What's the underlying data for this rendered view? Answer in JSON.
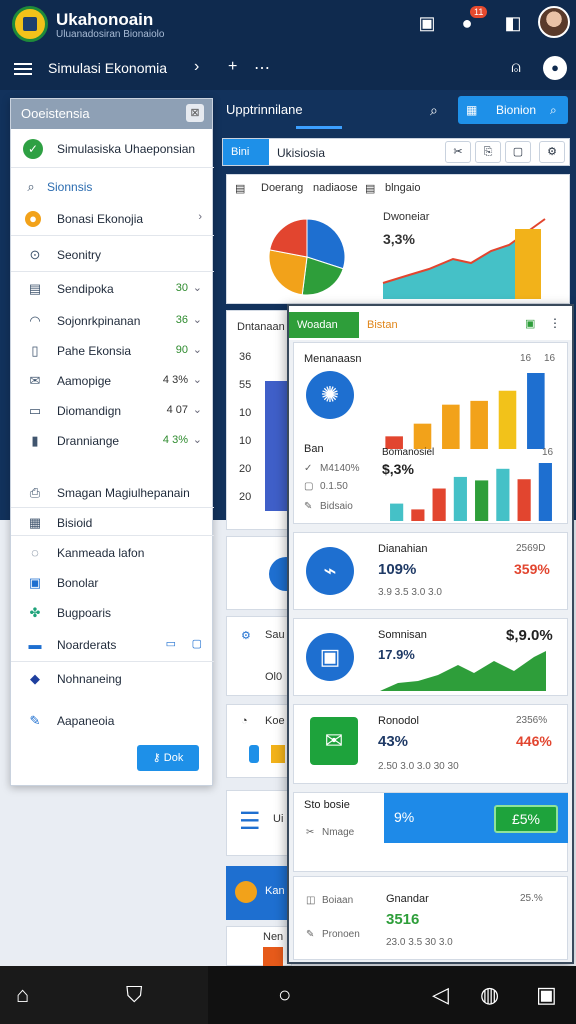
{
  "status": {
    "app_title": "Ukahonoain",
    "app_sub": "Uluanadosiran Bionaiolo",
    "notif_count": "11"
  },
  "appbar": {
    "title": "Simulasi Ekonomia"
  },
  "drawer": {
    "header": "Ooeistensia",
    "items": [
      {
        "label": "Simulasiska Uhaeponsian"
      },
      {
        "label": "Sionnsis"
      },
      {
        "label": "Bonasi Ekonojia"
      },
      {
        "label": "Seonitry"
      },
      {
        "label": "Sendipoka",
        "value": "30"
      },
      {
        "label": "Sojonrkpinanan",
        "value": "36"
      },
      {
        "label": "Pahe Ekonsia",
        "value": "90"
      },
      {
        "label": "Aamopige",
        "value": "4 3%"
      },
      {
        "label": "Diomandign",
        "value": "4 07"
      },
      {
        "label": "Dranniange",
        "value": "4 3%"
      },
      {
        "label": "Smagan Magiulhepanain"
      },
      {
        "label": "Bisioid"
      },
      {
        "label": "Kanmeada lafon"
      },
      {
        "label": "Bonolar"
      },
      {
        "label": "Bugpoaris"
      },
      {
        "label": "Noarderats"
      },
      {
        "label": "Nohnaneing"
      },
      {
        "label": "Aapaneoia"
      }
    ],
    "ok_label": "Dok"
  },
  "main": {
    "title": "Upptrinnilane",
    "top_button": "Bionion",
    "tab_active": "Bini",
    "tab_label": "Ukisiosia",
    "card1": {
      "header_left": "Doerang",
      "header_mid": "nadiaose",
      "header_right": "blngaio",
      "chart_label": "Dwoneiar",
      "chart_value": "3,3%"
    },
    "card2_label": "Dntanaan",
    "left_axis": [
      "36",
      "55",
      "10",
      "10",
      "20",
      "20"
    ],
    "card3_label": "Sau",
    "card3_val": "Ol0",
    "card4_label": "Koe",
    "card5_label": "Ui",
    "card6_label": "Kan",
    "card7_label": "Nen"
  },
  "overlay": {
    "tab_active": "Woadan",
    "tab2": "Bistan",
    "panel1": {
      "title": "Menanaasn",
      "label": "Ban",
      "r1": "M4140%",
      "r2": "0.1.50",
      "r3": "Bidsaio",
      "bar_label": "Bomanosiel",
      "bar_value": "$,3%",
      "axis": [
        "16",
        "16",
        "16"
      ]
    },
    "card_a": {
      "title": "Dianahian",
      "value": "109%",
      "right_label": "2569D",
      "right_value": "359%",
      "sub": "3.9 3.5 3.0 3.0"
    },
    "card_b": {
      "title": "Somnisan",
      "value": "17.9%",
      "right_value": "$,9.0%"
    },
    "card_c": {
      "title": "Ronodol",
      "value": "43%",
      "right_label": "2356%",
      "right_value": "446%",
      "sub": "2.50 3.0 3.0 30 30"
    },
    "card_d": {
      "title": "Sto bosie",
      "label2": "Nmage",
      "blue_value": "9%",
      "green_value": "£5%"
    },
    "card_e": {
      "label": "Boiaan",
      "label2": "Pronoen",
      "title": "Gnandar",
      "value": "3516",
      "right_label": "25.%",
      "sub": "23.0 3.5 30 3.0"
    }
  },
  "colors": {
    "navy": "#0f2a4e",
    "accent_blue": "#1e90e8",
    "green": "#2e9e3a",
    "orange": "#f2a21a",
    "red": "#e2452f"
  },
  "chart_data": [
    {
      "type": "pie",
      "values": [
        30,
        22,
        26,
        22
      ],
      "colors": [
        "#1e6fd0",
        "#2e9e3a",
        "#f2a21a",
        "#e2452f"
      ]
    },
    {
      "type": "bar",
      "categories": [
        "1",
        "2",
        "3",
        "4",
        "5",
        "6"
      ],
      "values": [
        1,
        2,
        3.5,
        3.8,
        4.6,
        6
      ],
      "colors": [
        "#e2452f",
        "#f2a21a",
        "#f2a21a",
        "#f2a21a",
        "#f2c21a",
        "#1e6fd0"
      ]
    },
    {
      "type": "bar",
      "categories": [
        "1",
        "2",
        "3",
        "4",
        "5",
        "6",
        "7",
        "8"
      ],
      "values": [
        1.5,
        1,
        2.8,
        3.8,
        3.5,
        4.5,
        3.6,
        5
      ],
      "colors": [
        "#45c1c7",
        "#e2452f",
        "#e2452f",
        "#45c1c7",
        "#2e9e3a",
        "#45c1c7",
        "#e2452f",
        "#1e6fd0"
      ]
    }
  ]
}
